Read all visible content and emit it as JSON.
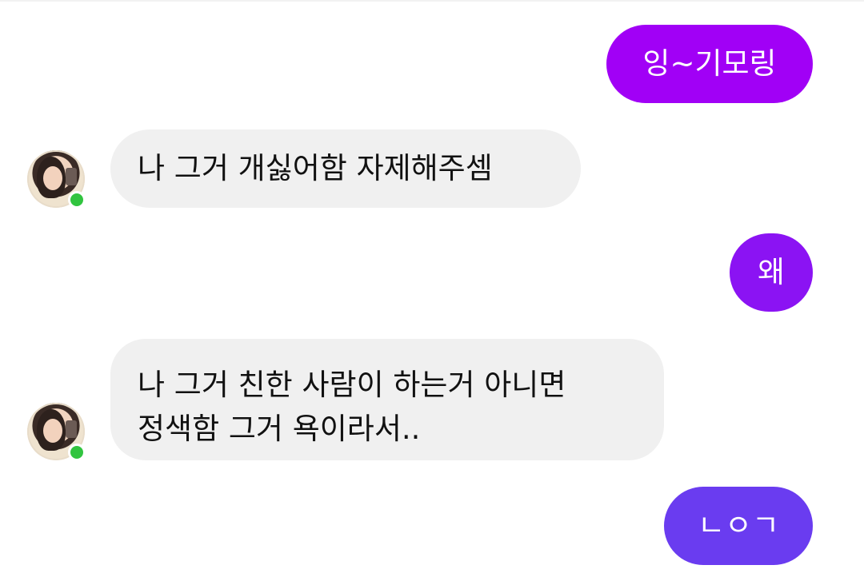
{
  "messages": [
    {
      "id": "m1",
      "direction": "outgoing",
      "text": "잉~기모링"
    },
    {
      "id": "m2",
      "direction": "incoming",
      "text": "나 그거 개싫어함 자제해주셈"
    },
    {
      "id": "m3",
      "direction": "outgoing",
      "text": "왜"
    },
    {
      "id": "m4",
      "direction": "incoming",
      "lines": [
        "나 그거 친한 사람이 하는거 아니면",
        "정색함 그거 욕이라서.."
      ]
    },
    {
      "id": "m5",
      "direction": "outgoing",
      "text": "ㄴㅇㄱ"
    }
  ],
  "contact": {
    "online": true,
    "avatar_icon": "profile-photo-avatar"
  },
  "colors": {
    "outgoing_top": "#a000f5",
    "outgoing_bottom": "#6a3cf0",
    "incoming_bg": "#f0f0f0",
    "online": "#31c43f"
  }
}
